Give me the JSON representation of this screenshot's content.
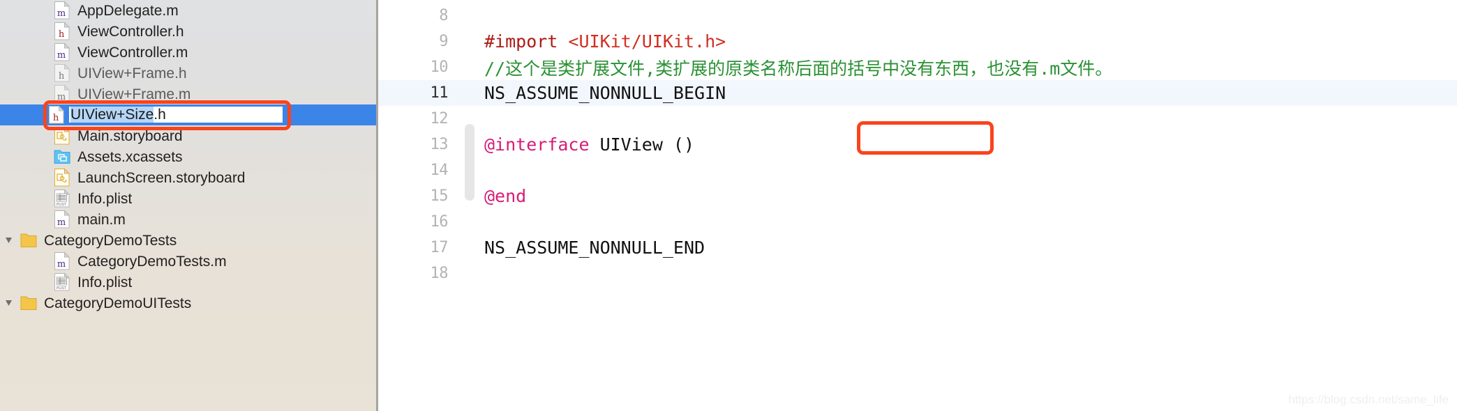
{
  "sidebar": {
    "selected_index": 5,
    "selection_color": "#3b84e8",
    "rename": {
      "selected_text": "UIView+Size",
      "remainder_text": ".h",
      "full_value": "UIView+Size.h",
      "selection_highlight_color": "#b6d6f8"
    },
    "items": [
      {
        "label": "AppDelegate.m",
        "icon": "objc-m-file-icon",
        "indent": 96,
        "state": "normal",
        "type": "file",
        "disclosure": ""
      },
      {
        "label": "ViewController.h",
        "icon": "objc-h-file-icon",
        "indent": 96,
        "state": "normal",
        "type": "file",
        "disclosure": ""
      },
      {
        "label": "ViewController.m",
        "icon": "objc-m-file-icon",
        "indent": 96,
        "state": "normal",
        "type": "file",
        "disclosure": ""
      },
      {
        "label": "UIView+Frame.h",
        "icon": "objc-h-file-icon",
        "indent": 96,
        "state": "dimmed",
        "type": "file",
        "disclosure": ""
      },
      {
        "label": "UIView+Frame.m",
        "icon": "objc-m-file-icon",
        "indent": 96,
        "state": "dimmed",
        "type": "file",
        "disclosure": ""
      },
      {
        "label": "UIView+Size.h",
        "icon": "objc-h-file-icon",
        "indent": 96,
        "state": "selected",
        "type": "file",
        "disclosure": ""
      },
      {
        "label": "Main.storyboard",
        "icon": "storyboard-file-icon",
        "indent": 96,
        "state": "normal",
        "type": "file",
        "disclosure": ""
      },
      {
        "label": "Assets.xcassets",
        "icon": "xcassets-folder-icon",
        "indent": 96,
        "state": "normal",
        "type": "file",
        "disclosure": ""
      },
      {
        "label": "LaunchScreen.storyboard",
        "icon": "storyboard-file-icon",
        "indent": 96,
        "state": "normal",
        "type": "file",
        "disclosure": ""
      },
      {
        "label": "Info.plist",
        "icon": "plist-file-icon",
        "indent": 96,
        "state": "normal",
        "type": "file",
        "disclosure": ""
      },
      {
        "label": "main.m",
        "icon": "objc-m-file-icon",
        "indent": 96,
        "state": "normal",
        "type": "file",
        "disclosure": ""
      },
      {
        "label": "CategoryDemoTests",
        "icon": "folder-icon",
        "indent": 22,
        "state": "normal",
        "type": "group",
        "disclosure": "expanded"
      },
      {
        "label": "CategoryDemoTests.m",
        "icon": "objc-m-file-icon",
        "indent": 96,
        "state": "normal",
        "type": "file",
        "disclosure": ""
      },
      {
        "label": "Info.plist",
        "icon": "plist-file-icon",
        "indent": 96,
        "state": "normal",
        "type": "file",
        "disclosure": ""
      },
      {
        "label": "CategoryDemoUITests",
        "icon": "folder-icon",
        "indent": 22,
        "state": "normal",
        "type": "group",
        "disclosure": "expanded"
      }
    ]
  },
  "editor": {
    "current_line": 11,
    "current_line_highlight": "#f2f6fd",
    "annotation_color": "#f9441c",
    "lines": [
      {
        "number": "8",
        "tokens": []
      },
      {
        "number": "9",
        "tokens": [
          {
            "text": "#import ",
            "kind": "pre"
          },
          {
            "text": "<UIKit/UIKit.h>",
            "kind": "str"
          }
        ]
      },
      {
        "number": "10",
        "tokens": [
          {
            "text": "//这个是类扩展文件,类扩展的原类名称后面的括号中没有东西，也没有.m文件。",
            "kind": "comment"
          }
        ]
      },
      {
        "number": "11",
        "tokens": [
          {
            "text": "NS_ASSUME_NONNULL_BEGIN",
            "kind": "plain"
          }
        ]
      },
      {
        "number": "12",
        "tokens": []
      },
      {
        "number": "13",
        "tokens": [
          {
            "text": "@interface",
            "kind": "kw"
          },
          {
            "text": " UIView ()",
            "kind": "plain"
          }
        ]
      },
      {
        "number": "14",
        "tokens": []
      },
      {
        "number": "15",
        "tokens": [
          {
            "text": "@end",
            "kind": "kw"
          }
        ]
      },
      {
        "number": "16",
        "tokens": []
      },
      {
        "number": "17",
        "tokens": [
          {
            "text": "NS_ASSUME_NONNULL_END",
            "kind": "plain"
          }
        ]
      },
      {
        "number": "18",
        "tokens": []
      }
    ]
  },
  "watermark": {
    "text": "https://blog.csdn.net/same_life"
  }
}
